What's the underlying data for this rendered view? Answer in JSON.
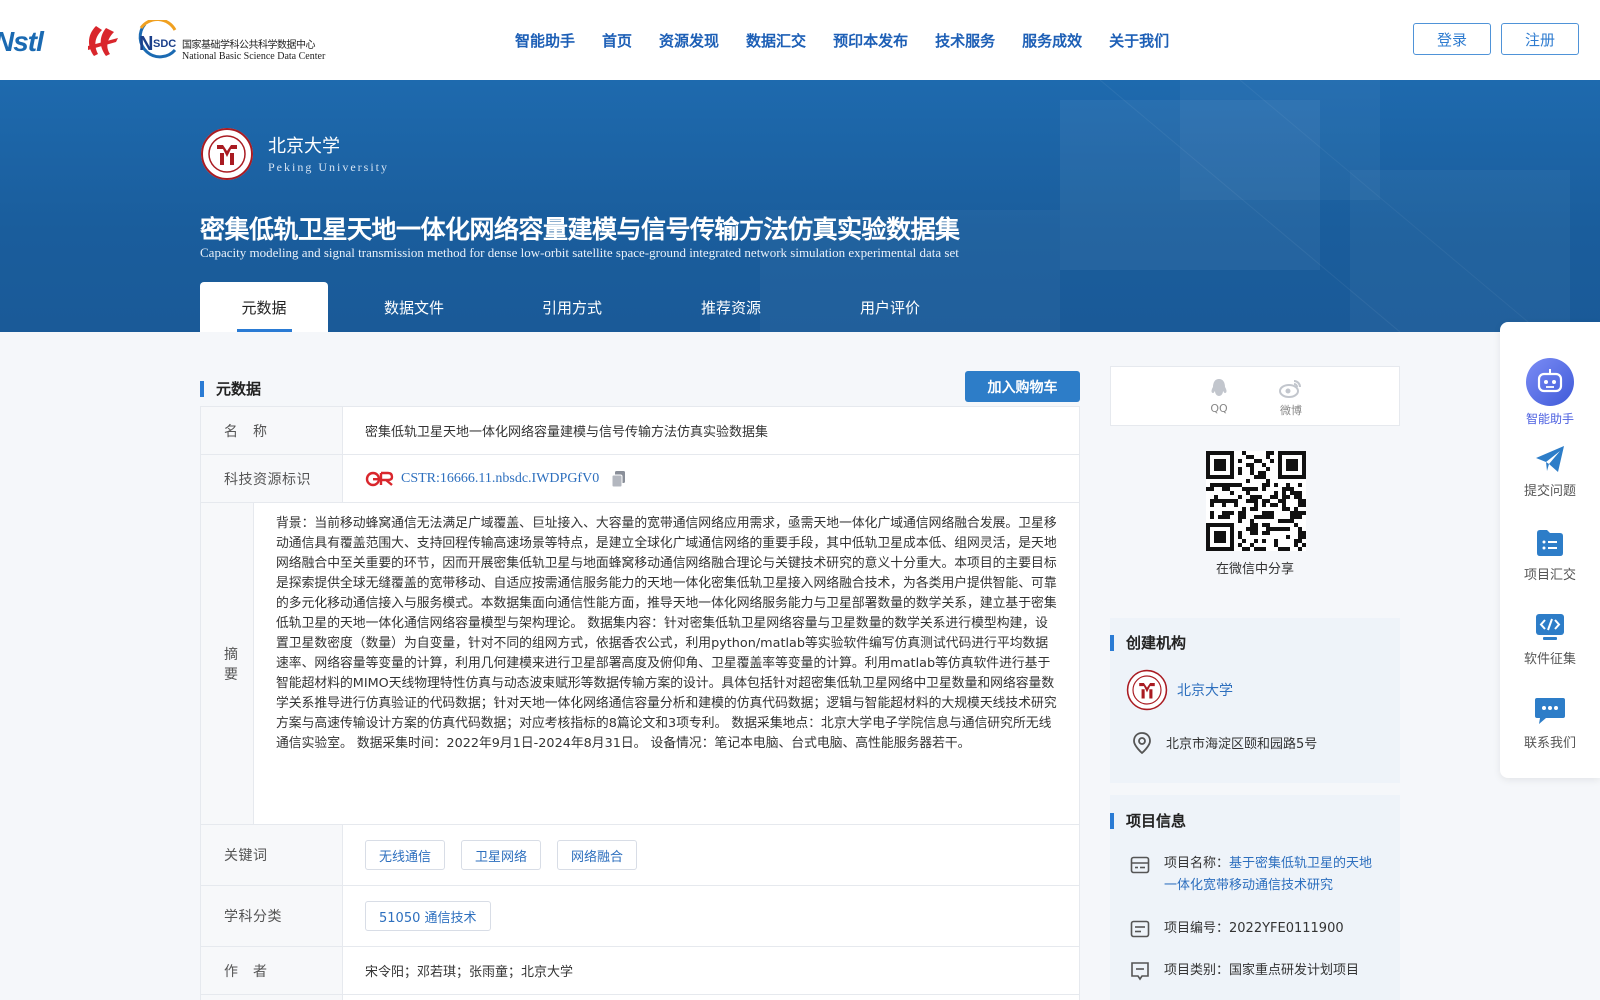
{
  "header": {
    "logo_nstl": "Nstl",
    "nsdc_cn": "国家基础学科公共科学数据中心",
    "nsdc_en": "National Basic Science Data Center",
    "nav": [
      "智能助手",
      "首页",
      "资源发现",
      "数据汇交",
      "预印本发布",
      "技术服务",
      "服务成效",
      "关于我们"
    ],
    "login_label": "登录",
    "register_label": "注册"
  },
  "hero": {
    "university_cn": "北京大学",
    "university_en": "Peking University",
    "title_cn": "密集低轨卫星天地一体化网络容量建模与信号传输方法仿真实验数据集",
    "title_en": "Capacity modeling and signal transmission method for dense low-orbit satellite space-ground integrated network simulation experimental data set",
    "tabs": [
      "元数据",
      "数据文件",
      "引用方式",
      "推荐资源",
      "用户评价"
    ]
  },
  "metadata": {
    "section_title": "元数据",
    "cart_label": "加入购物车",
    "rows": {
      "name_label": "名　称",
      "name_value": "密集低轨卫星天地一体化网络容量建模与信号传输方法仿真实验数据集",
      "id_label": "科技资源标识",
      "id_value": "CSTR:16666.11.nbsdc.IWDPGfV0",
      "abstract_label": "摘　要",
      "abstract_value": "背景：当前移动蜂窝通信无法满足广域覆盖、巨址接入、大容量的宽带通信网络应用需求，亟需天地一体化广域通信网络融合发展。卫星移动通信具有覆盖范围大、支持回程传输高速场景等特点，是建立全球化广域通信网络的重要手段，其中低轨卫星成本低、组网灵活，是天地网络融合中至关重要的环节，因而开展密集低轨卫星与地面蜂窝移动通信网络融合理论与关键技术研究的意义十分重大。本项目的主要目标是探索提供全球无缝覆盖的宽带移动、自适应按需通信服务能力的天地一体化密集低轨卫星接入网络融合技术，为各类用户提供智能、可靠的多元化移动通信接入与服务模式。本数据集面向通信性能方面，推导天地一体化网络服务能力与卫星部署数量的数学关系，建立基于密集低轨卫星的天地一体化通信网络容量模型与架构理论。 数据集内容：针对密集低轨卫星网络容量与卫星数量的数学关系进行模型构建，设置卫星数密度（数量）为自变量，针对不同的组网方式，依据香农公式，利用python/matlab等实验软件编写仿真测试代码进行平均数据速率、网络容量等变量的计算，利用几何建模来进行卫星部署高度及俯仰角、卫星覆盖率等变量的计算。利用matlab等仿真软件进行基于智能超材料的MIMO天线物理特性仿真与动态波束赋形等数据传输方案的设计。具体包括针对超密集低轨卫星网络中卫星数量和网络容量数学关系推导进行仿真验证的代码数据；针对天地一体化网络通信容量分析和建模的仿真代码数据；逻辑与智能超材料的大规模天线技术研究方案与高速传输设计方案的仿真代码数据；对应考核指标的8篇论文和3项专利。 数据采集地点：北京大学电子学院信息与通信研究所无线通信实验室。 数据采集时间：2022年9月1日-2024年8月31日。 设备情况：笔记本电脑、台式电脑、高性能服务器若干。",
      "keywords_label": "关键词",
      "keywords": [
        "无线通信",
        "卫星网络",
        "网络融合"
      ],
      "subject_label": "学科分类",
      "subject_value": "51050 通信技术",
      "author_label": "作　者",
      "author_value": "宋令阳；邓若琪；张雨童；北京大学"
    }
  },
  "sidebar": {
    "share_qq": "QQ",
    "share_weibo": "微博",
    "wechat_caption": "在微信中分享",
    "creator_title": "创建机构",
    "creator_name": "北京大学",
    "creator_address": "北京市海淀区颐和园路5号",
    "project_title": "项目信息",
    "project_name_label": "项目名称：",
    "project_name_value": "基于密集低轨卫星的天地一体化宽带移动通信技术研究",
    "project_code": "项目编号：2022YFE0111900",
    "project_type": "项目类别：国家重点研发计划项目"
  },
  "float_bar": {
    "items": [
      "智能助手",
      "提交问题",
      "项目汇交",
      "软件征集",
      "联系我们"
    ]
  },
  "colors": {
    "brand_blue": "#1d5fb6",
    "hero_blue": "#1e6aae",
    "accent": "#2a7bd4",
    "pku_red": "#a91b22"
  }
}
